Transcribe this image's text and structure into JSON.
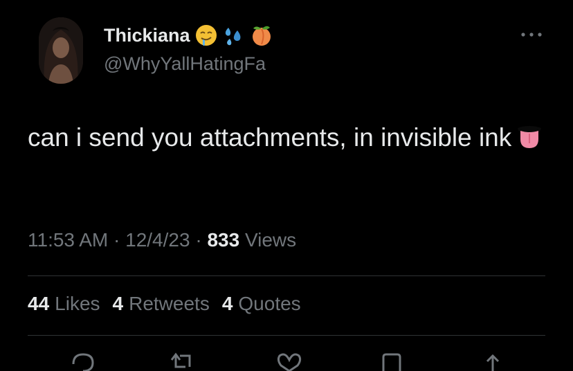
{
  "author": {
    "display_name": "Thickiana",
    "handle": "@WhyYallHatingFa",
    "name_emojis": [
      "drooling-face-emoji",
      "sweat-droplets-emoji",
      "peach-emoji"
    ]
  },
  "tweet": {
    "text": "can i send you attachments, in invisible ink",
    "trailing_emoji": "tongue-emoji"
  },
  "meta": {
    "time": "11:53 AM",
    "separator": "·",
    "date": "12/4/23",
    "views_count": "833",
    "views_label": "Views"
  },
  "stats": {
    "likes_count": "44",
    "likes_label": "Likes",
    "retweets_count": "4",
    "retweets_label": "Retweets",
    "quotes_count": "4",
    "quotes_label": "Quotes"
  },
  "actions": [
    "reply-icon",
    "retweet-icon",
    "like-icon",
    "bookmark-icon",
    "share-icon"
  ],
  "colors": {
    "background": "#000000",
    "primary_text": "#e7e9ea",
    "secondary_text": "#71767b",
    "divider": "#2f3336"
  }
}
